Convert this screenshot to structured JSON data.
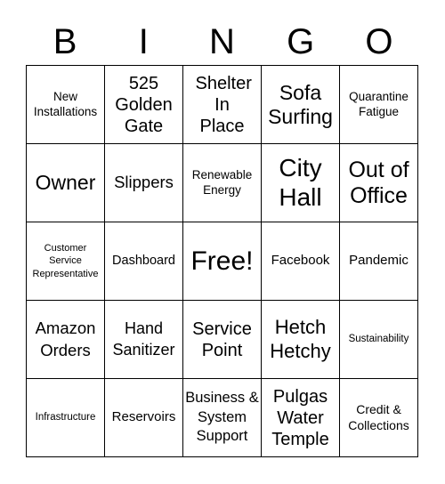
{
  "header": {
    "letters": [
      "B",
      "I",
      "N",
      "G",
      "O"
    ]
  },
  "board": {
    "rows": [
      [
        {
          "text": "New Installations"
        },
        {
          "text": "525 Golden Gate"
        },
        {
          "text": "Shelter In Place"
        },
        {
          "text": "Sofa Surfing"
        },
        {
          "text": "Quarantine Fatigue"
        }
      ],
      [
        {
          "text": "Owner"
        },
        {
          "text": "Slippers"
        },
        {
          "text": "Renewable Energy"
        },
        {
          "text": "City Hall"
        },
        {
          "text": "Out of Office"
        }
      ],
      [
        {
          "text": "Customer Service Representative"
        },
        {
          "text": "Dashboard"
        },
        {
          "text": "Free!"
        },
        {
          "text": "Facebook"
        },
        {
          "text": "Pandemic"
        }
      ],
      [
        {
          "text": "Amazon Orders"
        },
        {
          "text": "Hand Sanitizer"
        },
        {
          "text": "Service Point"
        },
        {
          "text": "Hetch Hetchy"
        },
        {
          "text": "Sustainability"
        }
      ],
      [
        {
          "text": "Infrastructure"
        },
        {
          "text": "Reservoirs"
        },
        {
          "text": "Business & System Support"
        },
        {
          "text": "Pulgas Water Temple"
        },
        {
          "text": "Credit & Collections"
        }
      ]
    ]
  }
}
